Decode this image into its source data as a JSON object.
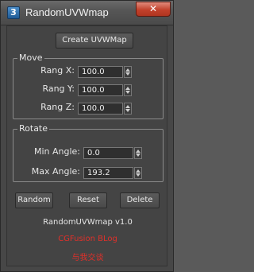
{
  "window": {
    "icon_glyph": "3",
    "title": "RandomUVWmap",
    "close_glyph": "✕"
  },
  "toolbar": {
    "create_label": "Create UVWMap"
  },
  "move": {
    "group_label": "Move",
    "rows": [
      {
        "label": "Rang X:",
        "value": "100.0"
      },
      {
        "label": "Rang Y:",
        "value": "100.0"
      },
      {
        "label": "Rang Z:",
        "value": "100.0"
      }
    ]
  },
  "rotate": {
    "group_label": "Rotate",
    "rows": [
      {
        "label": "Min Angle:",
        "value": "0.0"
      },
      {
        "label": "Max Angle:",
        "value": "193.2"
      }
    ]
  },
  "actions": {
    "random_label": "Random",
    "reset_label": "Reset",
    "delete_label": "Delete"
  },
  "footer": {
    "version": "RandomUVWmap v1.0",
    "blog": "CGFusion BLog",
    "contact": "与我交谈"
  },
  "colors": {
    "link_red": "#e0302a",
    "close_red": "#c2412c"
  }
}
